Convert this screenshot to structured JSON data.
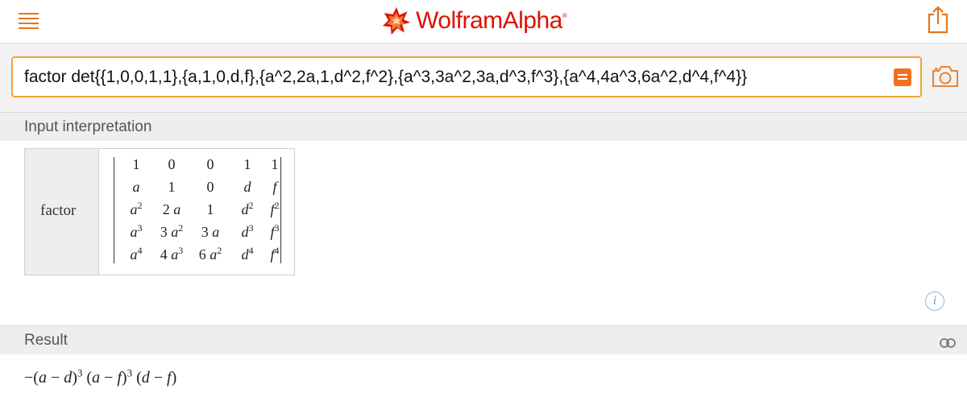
{
  "header": {
    "logo_text": "WolframAlpha",
    "logo_mark": "®",
    "icons": {
      "menu": "menu-icon",
      "share": "share-icon",
      "logo": "wolfram-spikey-icon"
    },
    "colors": {
      "accent": "#e4761b",
      "logo_red": "#dd1100"
    }
  },
  "search": {
    "query": "factor det{{1,0,0,1,1},{a,1,0,d,f},{a^2,2a,1,d^2,f^2},{a^3,3a^2,3a,d^3,f^3},{a^4,4a^3,6a^2,d^4,f^4}}",
    "icons": {
      "equal": "equal-icon",
      "camera": "camera-icon"
    },
    "border_color": "#f2a33a"
  },
  "pods": {
    "input_interpretation": {
      "title": "Input interpretation",
      "label": "factor",
      "matrix_rows": [
        [
          {
            "b": "1"
          },
          {
            "b": "0"
          },
          {
            "b": "0"
          },
          {
            "b": "1"
          },
          {
            "b": "1"
          }
        ],
        [
          {
            "v": "a"
          },
          {
            "b": "1"
          },
          {
            "b": "0"
          },
          {
            "v": "d"
          },
          {
            "v": "f"
          }
        ],
        [
          {
            "v": "a",
            "e": "2"
          },
          {
            "b": "2 ",
            "v": "a"
          },
          {
            "b": "1"
          },
          {
            "v": "d",
            "e": "2"
          },
          {
            "v": "f",
            "e": "2"
          }
        ],
        [
          {
            "v": "a",
            "e": "3"
          },
          {
            "b": "3 ",
            "v": "a",
            "e": "2"
          },
          {
            "b": "3 ",
            "v": "a"
          },
          {
            "v": "d",
            "e": "3"
          },
          {
            "v": "f",
            "e": "3"
          }
        ],
        [
          {
            "v": "a",
            "e": "4"
          },
          {
            "b": "4 ",
            "v": "a",
            "e": "3"
          },
          {
            "b": "6 ",
            "v": "a",
            "e": "2"
          },
          {
            "v": "d",
            "e": "4"
          },
          {
            "v": "f",
            "e": "4"
          }
        ]
      ],
      "info_icon_text": "i"
    },
    "result": {
      "title": "Result",
      "link_icon": "link-icon",
      "expression": [
        {
          "t": "−("
        },
        {
          "v": "a"
        },
        {
          "t": " − "
        },
        {
          "v": "d"
        },
        {
          "t": ")"
        },
        {
          "e": "3"
        },
        {
          "t": " ("
        },
        {
          "v": "a"
        },
        {
          "t": " − "
        },
        {
          "v": "f"
        },
        {
          "t": ")"
        },
        {
          "e": "3"
        },
        {
          "t": " ("
        },
        {
          "v": "d"
        },
        {
          "t": " − "
        },
        {
          "v": "f"
        },
        {
          "t": ")"
        }
      ]
    }
  }
}
